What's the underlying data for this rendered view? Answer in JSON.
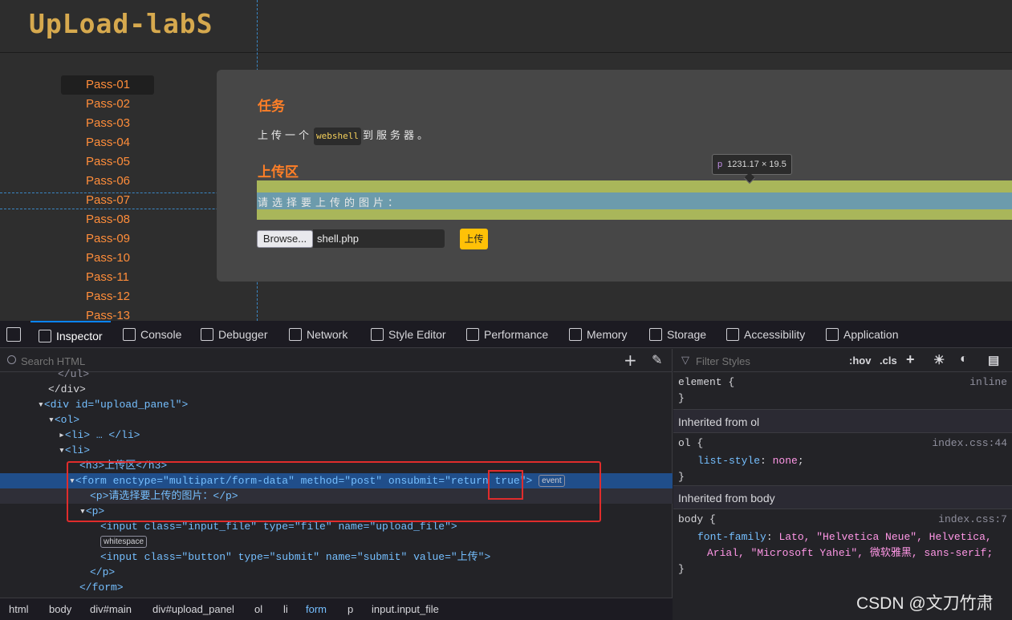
{
  "page": {
    "logo": "UpLoad-labS",
    "menu": [
      "Pass-01",
      "Pass-02",
      "Pass-03",
      "Pass-04",
      "Pass-05",
      "Pass-06",
      "Pass-07",
      "Pass-08",
      "Pass-09",
      "Pass-10",
      "Pass-11",
      "Pass-12",
      "Pass-13"
    ],
    "task_heading": "任务",
    "task_prefix": "上传一个",
    "task_code": "webshell",
    "task_suffix": "到服务器。",
    "upload_heading": "上传区",
    "prompt": "请选择要上传的图片：",
    "browse_label": "Browse...",
    "file_name": "shell.php",
    "upload_label": "上传",
    "tooltip_tag": "p",
    "tooltip_size": "1231.17 × 19.5"
  },
  "devtools": {
    "tabs": [
      "Inspector",
      "Console",
      "Debugger",
      "Network",
      "Style Editor",
      "Performance",
      "Memory",
      "Storage",
      "Accessibility",
      "Application"
    ],
    "search_placeholder": "Search HTML",
    "html_lines": [
      "</ul>",
      "</div>",
      "<div id=\"upload_panel\">",
      "<ol>",
      "<li> … </li>",
      "<li>",
      "<h3>上传区</h3>",
      "<form enctype=\"multipart/form-data\" method=\"post\" onsubmit=\"return true\">",
      "<p>请选择要上传的图片：</p>",
      "<p>",
      "<input class=\"input_file\" type=\"file\" name=\"upload_file\">",
      "whitespace",
      "<input class=\"button\" type=\"submit\" name=\"submit\" value=\"上传\">",
      "</p>",
      "</form>"
    ],
    "event_badge": "event",
    "breadcrumbs": [
      "html",
      "body",
      "div#main",
      "div#upload_panel",
      "ol",
      "li",
      "form",
      "p",
      "input.input_file"
    ],
    "styles": {
      "filter_placeholder": "Filter Styles",
      "hov": ":hov",
      "cls": ".cls",
      "element_selector": "element {",
      "element_source": "inline",
      "inherited_ol": "Inherited from ol",
      "ol_selector": "ol",
      "ol_source": "index.css:44",
      "ol_prop": "list-style",
      "ol_value": "none",
      "inherited_body": "Inherited from body",
      "body_selector": "body",
      "body_source": "index.css:7",
      "body_prop": "font-family",
      "body_value_1": "Lato, \"Helvetica Neue\", Helvetica,",
      "body_value_2": "Arial, \"Microsoft Yahei\", 微软雅黑, sans-serif;"
    }
  },
  "watermark": "CSDN @文刀竹肃"
}
